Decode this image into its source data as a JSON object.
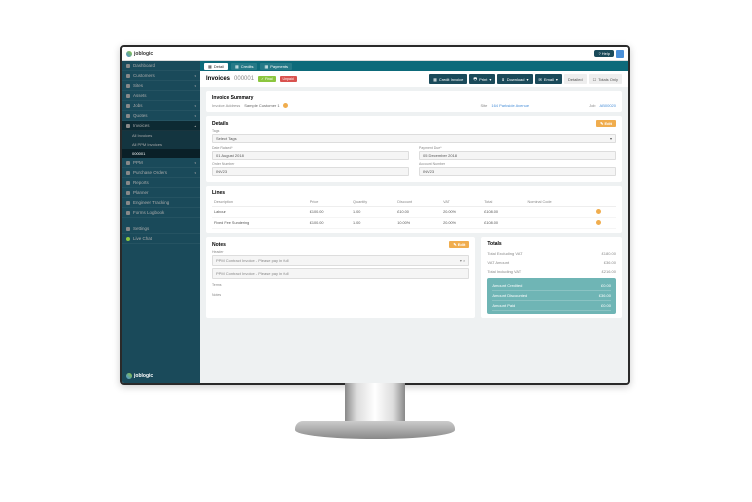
{
  "brand": "joblogic",
  "help": "? Help",
  "sidebar": {
    "items": [
      {
        "label": "Dashboard"
      },
      {
        "label": "Customers"
      },
      {
        "label": "Sites"
      },
      {
        "label": "Assets"
      },
      {
        "label": "Jobs"
      },
      {
        "label": "Quotes"
      },
      {
        "label": "Invoices"
      }
    ],
    "subs": [
      {
        "label": "All Invoices"
      },
      {
        "label": "All PPM Invoices"
      },
      {
        "label": "000001"
      }
    ],
    "items2": [
      {
        "label": "PPM"
      },
      {
        "label": "Purchase Orders"
      },
      {
        "label": "Reports"
      },
      {
        "label": "Planner"
      },
      {
        "label": "Engineer Tracking"
      },
      {
        "label": "Forms Logbook"
      }
    ],
    "settings": "Settings",
    "chat": "Live Chat"
  },
  "tabs": [
    {
      "label": "Detail"
    },
    {
      "label": "Credits"
    },
    {
      "label": "Payments"
    }
  ],
  "page": {
    "title": "Invoices",
    "number": "000001",
    "badge1": "✓ Final",
    "badge2": "Unpaid",
    "buttons": {
      "credit": "Credit Invoice",
      "print": "Print",
      "download": "Download",
      "email": "Email",
      "detailed": "Detailed",
      "totals": "Totals Only"
    }
  },
  "summary": {
    "title": "Invoice Summary",
    "addr_lbl": "Invoice Address",
    "addr_val": "Sample Customer 1",
    "site_lbl": "Site",
    "site_val": "164 Parkside Avenue",
    "job_lbl": "Job",
    "job_val": "AB00020"
  },
  "details": {
    "title": "Details",
    "edit": "Edit",
    "tags_lbl": "Tags",
    "tags_ph": "Select Tags",
    "date_raised_lbl": "Date Raised*",
    "date_raised": "01 August 2018",
    "pay_due_lbl": "Payment Due*",
    "pay_due": "05 December 2018",
    "order_lbl": "Order Number",
    "order": "INV23",
    "acct_lbl": "Account Number",
    "acct": "INV23"
  },
  "lines": {
    "title": "Lines",
    "cols": [
      "Description",
      "Price",
      "Quantity",
      "Discount",
      "VAT",
      "Total",
      "Nominal Code"
    ],
    "rows": [
      [
        "Labour",
        "£100.00",
        "1.00",
        "£10.00",
        "20.00%",
        "£108.00",
        ""
      ],
      [
        "Fixed Fee Sundering",
        "£100.00",
        "1.00",
        "10.00%",
        "20.00%",
        "£108.00",
        ""
      ]
    ]
  },
  "notes": {
    "title": "Notes",
    "edit": "Edit",
    "header_lbl": "Header",
    "header_val": "PPM Contract Invoice - Please pay in full",
    "line2": "PPM Contract Invoice - Please pay in full",
    "terms_lbl": "Terms",
    "notes_lbl": "Notes"
  },
  "totals": {
    "title": "Totals",
    "rows": [
      {
        "l": "Total Excluding VAT",
        "v": "£180.00"
      },
      {
        "l": "VAT Amount",
        "v": "£36.00"
      },
      {
        "l": "Total Including VAT",
        "v": "£216.00"
      }
    ],
    "box": [
      {
        "l": "Amount Credited",
        "v": "£0.00"
      },
      {
        "l": "Amount Discounted",
        "v": "£36.00"
      },
      {
        "l": "Amount Paid",
        "v": "£0.00"
      }
    ]
  }
}
